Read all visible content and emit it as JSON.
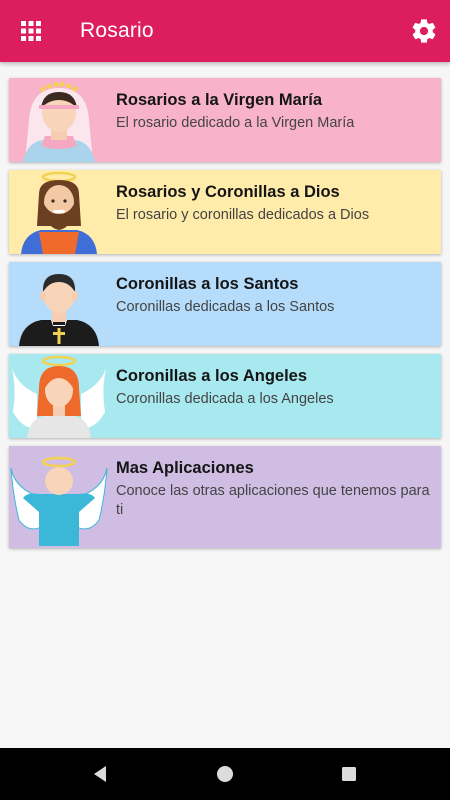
{
  "app": {
    "title": "Rosario",
    "colors": {
      "appbar": "#dc1e5f",
      "background": "#f6f6f6"
    }
  },
  "toolbar": {
    "menu_icon": "grid-menu-icon",
    "settings_icon": "gear-icon"
  },
  "cards": [
    {
      "title": "Rosarios a la Virgen María",
      "subtitle": "El rosario dedicado a la Virgen María",
      "color": "#f8b2c9",
      "icon": "virgin-mary-icon"
    },
    {
      "title": "Rosarios y Coronillas a Dios",
      "subtitle": "El rosario  y coronillas dedicados a Dios",
      "color": "#ffecaa",
      "icon": "jesus-icon"
    },
    {
      "title": "Coronillas a los Santos",
      "subtitle": "Coronillas dedicadas a los Santos",
      "color": "#b5dcfa",
      "icon": "priest-icon"
    },
    {
      "title": "Coronillas a los Angeles",
      "subtitle": "Coronillas dedicada a los Angeles",
      "color": "#a8e8ef",
      "icon": "angel-woman-icon"
    },
    {
      "title": "Mas Aplicaciones",
      "subtitle": "Conoce las otras aplicaciones que tenemos para ti",
      "color": "#cfbde4",
      "icon": "angel-icon"
    }
  ],
  "navigation": {
    "back_icon": "back-icon",
    "home_icon": "home-icon",
    "recents_icon": "recents-icon"
  }
}
